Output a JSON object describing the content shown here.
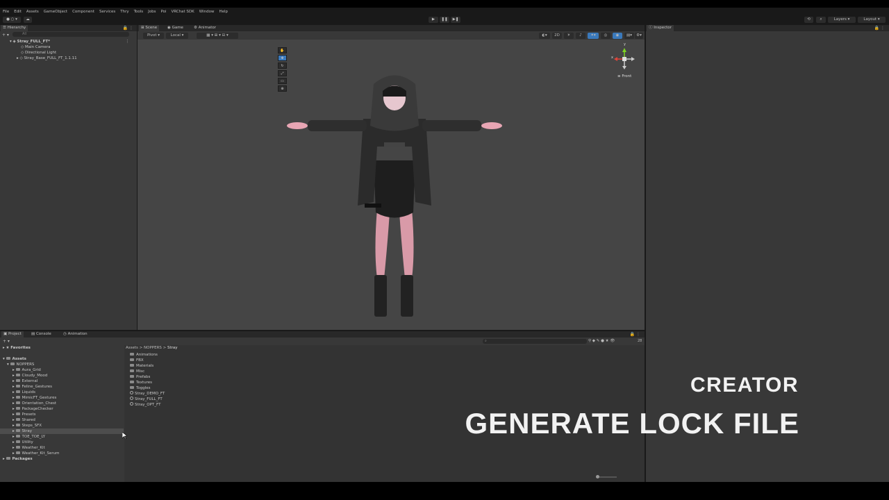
{
  "menubar": [
    "File",
    "Edit",
    "Assets",
    "GameObject",
    "Component",
    "Services",
    "Thry",
    "Tools",
    "Jobs",
    "Poi",
    "VRChat SDK",
    "Window",
    "Help"
  ],
  "toolbar": {
    "layers_label": "Layers",
    "layout_label": "Layout"
  },
  "hierarchy": {
    "tab_label": "Hierarchy",
    "search_placeholder": "All",
    "scene_name": "Stray_FULL_FT*",
    "items": [
      "Main Camera",
      "Directional Light",
      "Stray_Base_FULL_FT_1.1.11"
    ]
  },
  "scene": {
    "tabs": [
      "Scene",
      "Game",
      "Animator"
    ],
    "pivot_label": "Pivot",
    "local_label": "Local",
    "mode_2d": "2D",
    "gizmo_view": "Front",
    "gizmo_axes": {
      "x": "x",
      "y": "y"
    }
  },
  "inspector": {
    "tab_label": "Inspector"
  },
  "project": {
    "tabs": [
      "Project",
      "Console",
      "Animation"
    ],
    "favorites_label": "Favorites",
    "assets_label": "Assets",
    "root_folder": "NOPPERS",
    "folders": [
      "Aura_Grid",
      "Cloudy_Mood",
      "External",
      "Feline_Gestures",
      "Liquids",
      "MimicFT_Gestures",
      "Orientation_Chest",
      "PackageChecker",
      "Presets",
      "Shared",
      "Steps_SFX",
      "Stray",
      "TOE_TOE_LY",
      "Utility",
      "Weather_Kit",
      "Weather_Kit_Serum"
    ],
    "selected_folder": "Stray",
    "packages_label": "Packages",
    "breadcrumb": [
      "Assets",
      "NOPPERS",
      "Stray"
    ],
    "contents": [
      {
        "name": "Animations",
        "kind": "folder"
      },
      {
        "name": "FBX",
        "kind": "folder"
      },
      {
        "name": "Materials",
        "kind": "folder"
      },
      {
        "name": "Misc",
        "kind": "folder"
      },
      {
        "name": "Prefabs",
        "kind": "folder"
      },
      {
        "name": "Textures",
        "kind": "folder"
      },
      {
        "name": "Toggles",
        "kind": "folder"
      },
      {
        "name": "Stray_DEMO_FT",
        "kind": "prefab"
      },
      {
        "name": "Stray_FULL_FT",
        "kind": "prefab"
      },
      {
        "name": "Stray_OPT_FT",
        "kind": "prefab"
      }
    ],
    "hidden_count": "28"
  },
  "overlay": {
    "subtitle": "CREATOR",
    "title": "GENERATE LOCK FILE"
  },
  "colors": {
    "panel_bg": "#383838",
    "tabbar_bg": "#282828",
    "selected_row": "#4d4d4d",
    "accent_blue": "#3a79bb"
  }
}
